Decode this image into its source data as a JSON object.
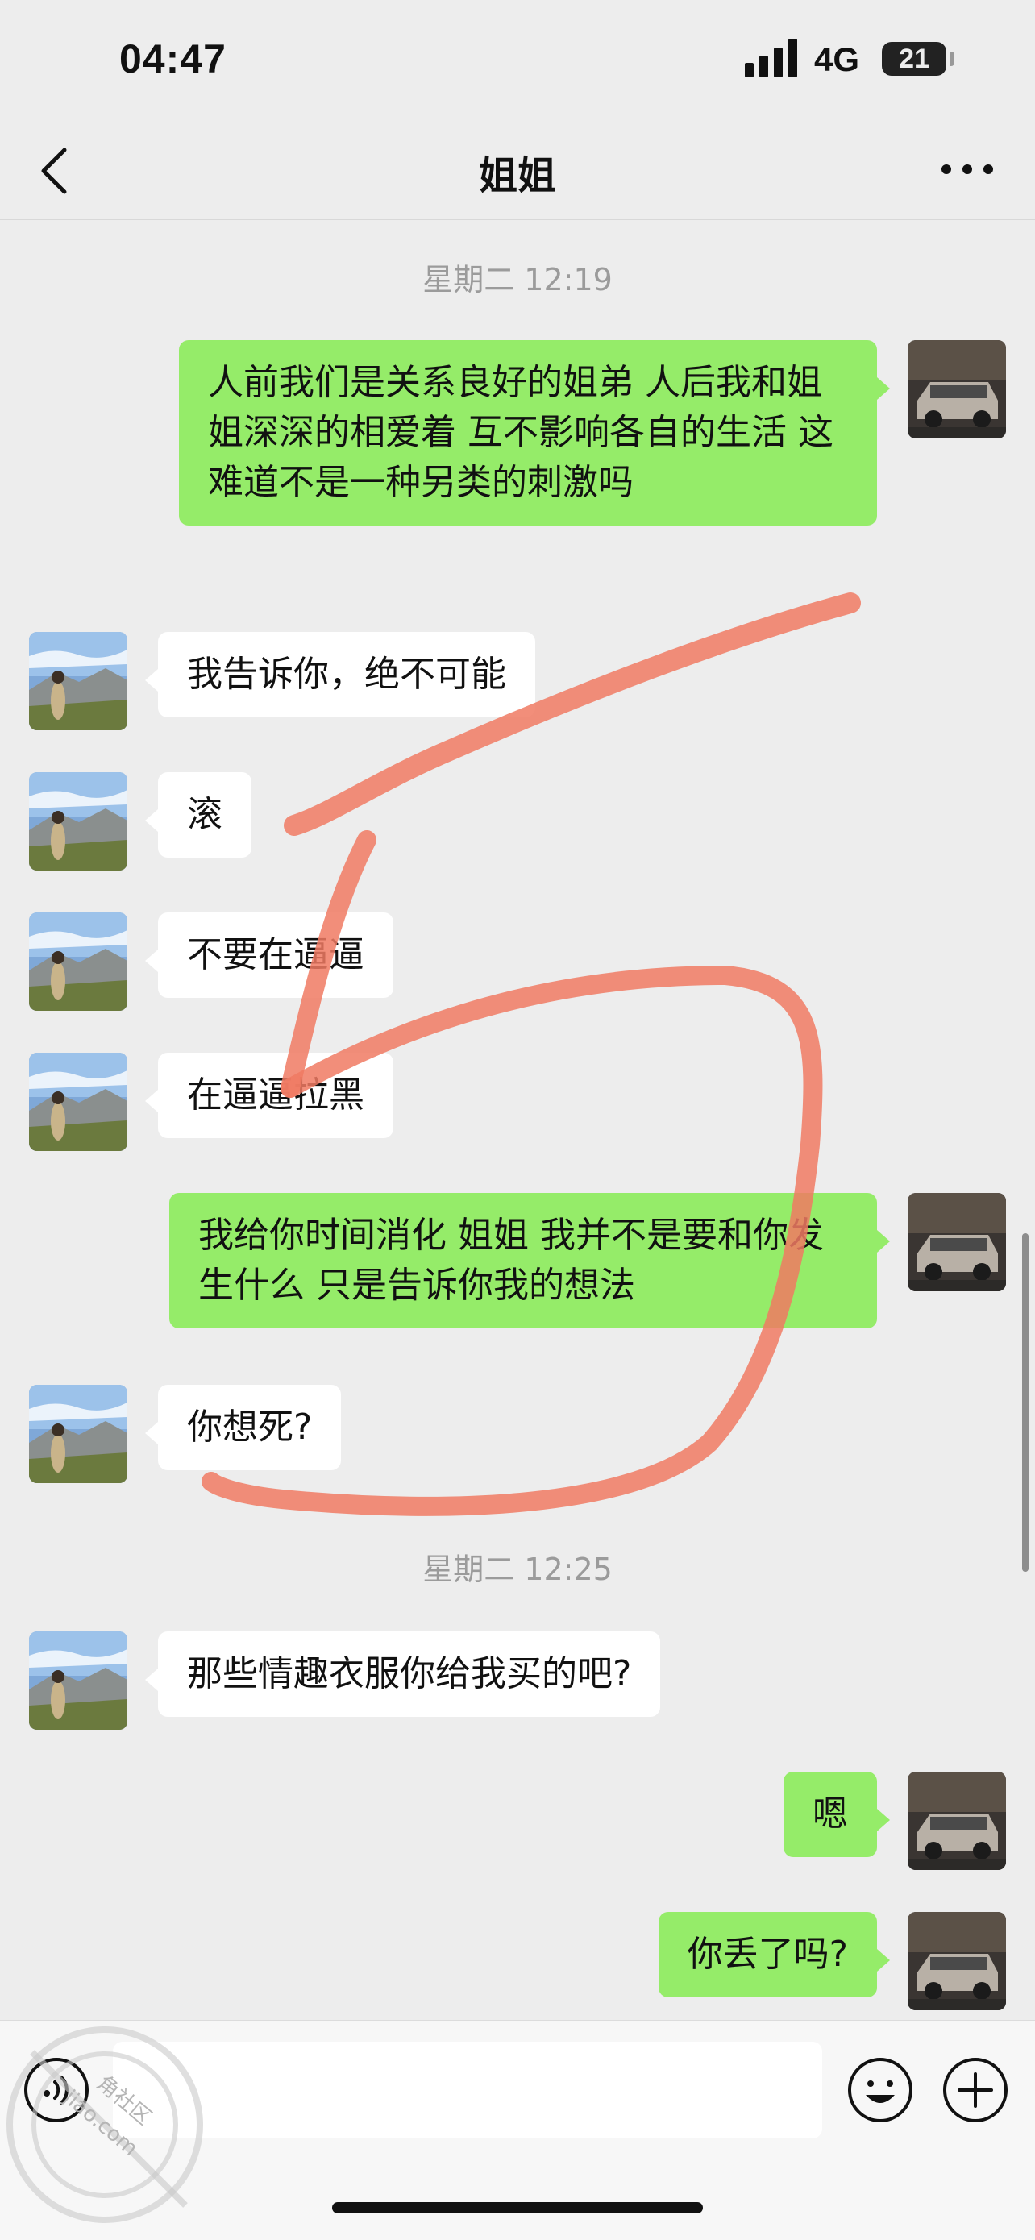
{
  "status_bar": {
    "time": "04:47",
    "network": "4G",
    "battery": "21"
  },
  "nav": {
    "title": "姐姐"
  },
  "timestamps": [
    "星期二 12:19",
    "星期二 12:25"
  ],
  "messages": [
    {
      "side": "out",
      "text": "人前我们是关系良好的姐弟 人后我和姐姐深深的相爱着 互不影响各自的生活 这难道不是一种另类的刺激吗"
    },
    {
      "side": "in",
      "text": "我告诉你，绝不可能"
    },
    {
      "side": "in",
      "text": "滚"
    },
    {
      "side": "in",
      "text": "不要在逼逼"
    },
    {
      "side": "in",
      "text": "在逼逼拉黑"
    },
    {
      "side": "out",
      "text": "我给你时间消化 姐姐 我并不是要和你发生什么 只是告诉你我的想法"
    },
    {
      "side": "in",
      "text": "你想死?"
    },
    {
      "side": "in",
      "text": "那些情趣衣服你给我买的吧?"
    },
    {
      "side": "out",
      "text": "嗯"
    },
    {
      "side": "out",
      "text": "你丢了吗?"
    }
  ],
  "input_bar": {
    "voice_icon": "voice-icon",
    "emoji_icon": "emoji-icon",
    "plus_icon": "plus-icon"
  },
  "watermark": {
    "text": "jiao.com",
    "text2": "角社区"
  },
  "colors": {
    "outgoing_bubble": "#95ec69",
    "incoming_bubble": "#ffffff",
    "background": "#ededed",
    "annotation_stroke": "#f07a63"
  }
}
